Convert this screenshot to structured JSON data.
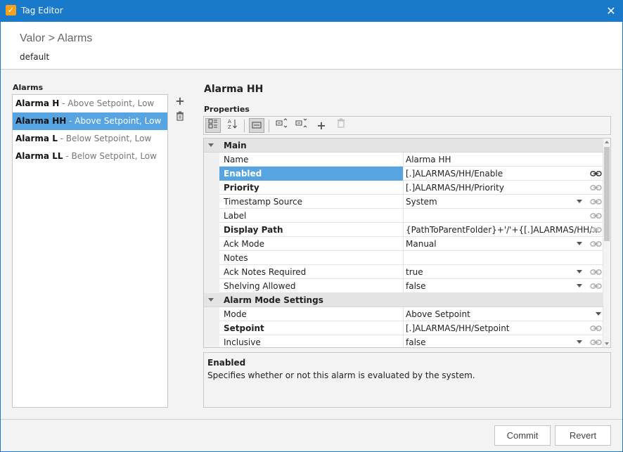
{
  "window": {
    "title": "Tag Editor",
    "app_icon_glyph": "✓",
    "close_glyph": "✕"
  },
  "header": {
    "breadcrumb": "Valor > Alarms",
    "provider": "default"
  },
  "alarms_panel": {
    "label": "Alarms",
    "items": [
      {
        "name": "Alarma H",
        "desc": " - Above Setpoint, Low"
      },
      {
        "name": "Alarma HH",
        "desc": " - Above Setpoint, Low"
      },
      {
        "name": "Alarma L",
        "desc": " - Below Setpoint, Low"
      },
      {
        "name": "Alarma LL",
        "desc": " - Below Setpoint, Low"
      }
    ],
    "selected_index": 1,
    "add_icon": "+",
    "delete_icon": "🗑"
  },
  "editor": {
    "title": "Alarma HH",
    "properties_label": "Properties",
    "toolbar": {
      "categorized_icon": "☷",
      "alphabetical_icon": "A↓",
      "show_desc_icon": "▭",
      "bind_icon": "⇅",
      "unbind_icon": "⇵",
      "add_icon": "+",
      "delete_icon": "🗑"
    },
    "categories": [
      {
        "name": "Main",
        "rows": [
          {
            "name": "Name",
            "value": "Alarma HH",
            "bold": false,
            "dropdown": false,
            "link": false
          },
          {
            "name": "Enabled",
            "value": "[.]ALARMAS/HH/Enable",
            "bold": true,
            "dropdown": false,
            "link": true,
            "selected": true
          },
          {
            "name": "Priority",
            "value": "[.]ALARMAS/HH/Priority",
            "bold": true,
            "dropdown": false,
            "link": true
          },
          {
            "name": "Timestamp Source",
            "value": "System",
            "bold": false,
            "dropdown": true,
            "link": true
          },
          {
            "name": "Label",
            "value": "",
            "bold": false,
            "dropdown": false,
            "link": true
          },
          {
            "name": "Display Path",
            "value": "{PathToParentFolder}+'/'+{[.]ALARMAS/HH/...",
            "bold": true,
            "dropdown": false,
            "link": true
          },
          {
            "name": "Ack Mode",
            "value": "Manual",
            "bold": false,
            "dropdown": true,
            "link": true
          },
          {
            "name": "Notes",
            "value": "",
            "bold": false,
            "dropdown": false,
            "link": false
          },
          {
            "name": "Ack Notes Required",
            "value": "true",
            "bold": false,
            "dropdown": true,
            "link": true
          },
          {
            "name": "Shelving Allowed",
            "value": "false",
            "bold": false,
            "dropdown": true,
            "link": true
          }
        ]
      },
      {
        "name": "Alarm Mode Settings",
        "rows": [
          {
            "name": "Mode",
            "value": "Above Setpoint",
            "bold": false,
            "dropdown": true,
            "link": false
          },
          {
            "name": "Setpoint",
            "value": "[.]ALARMAS/HH/Setpoint",
            "bold": true,
            "dropdown": false,
            "link": true
          },
          {
            "name": "Inclusive",
            "value": "false",
            "bold": false,
            "dropdown": true,
            "link": true
          }
        ]
      }
    ],
    "description": {
      "title": "Enabled",
      "text": "Specifies whether or not this alarm is evaluated by the system."
    }
  },
  "footer": {
    "commit_label": "Commit",
    "revert_label": "Revert"
  },
  "colors": {
    "titlebar": "#1979ca",
    "selection": "#56a4e1",
    "panel_bg": "#f3f3f3"
  }
}
